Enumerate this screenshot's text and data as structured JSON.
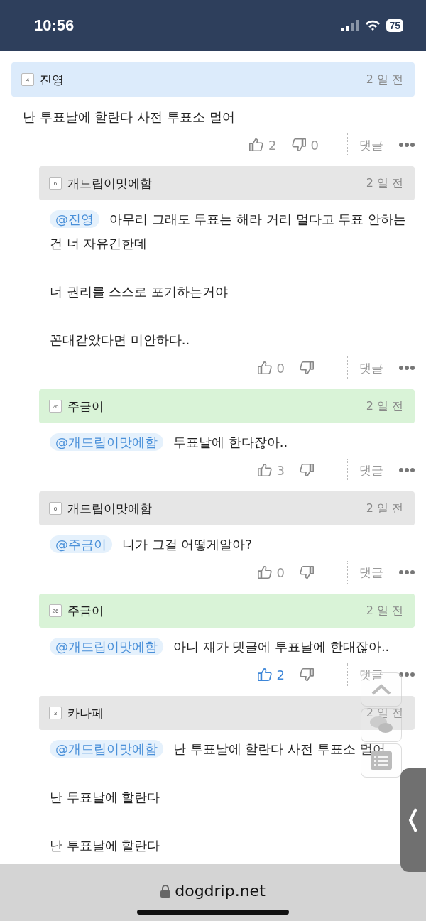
{
  "status_bar": {
    "time": "10:56",
    "battery": "75"
  },
  "comments": [
    {
      "badge": "4",
      "author": "진영",
      "time": "2 일 전",
      "color": "#dcebfb",
      "nested": false,
      "paragraphs": [
        "난 투표날에 할란다 사전 투표소 멀어"
      ],
      "likes": "2",
      "dislikes": "0",
      "liked": false,
      "reply": "댓글"
    },
    {
      "badge": "6",
      "author": "개드립이맛에함",
      "time": "2 일 전",
      "color": "#e6e6e6",
      "nested": true,
      "mention": "@진영",
      "paragraphs": [
        "아무리 그래도 투표는 해라 거리 멀다고 투표 안하는건 너 자유긴한데",
        "너 권리를 스스로 포기하는거야",
        "꼰대같았다면 미안하다.."
      ],
      "likes": "0",
      "liked": false,
      "reply": "댓글"
    },
    {
      "badge": "26",
      "author": "주금이",
      "time": "2 일 전",
      "color": "#d9f3d7",
      "nested": true,
      "mention": "@개드립이맛에함",
      "paragraphs": [
        "투표날에 한다잖아.."
      ],
      "likes": "3",
      "liked": false,
      "reply": "댓글"
    },
    {
      "badge": "6",
      "author": "개드립이맛에함",
      "time": "2 일 전",
      "color": "#e6e6e6",
      "nested": true,
      "mention": "@주금이",
      "paragraphs": [
        "니가 그걸 어떻게알아?"
      ],
      "likes": "0",
      "liked": false,
      "reply": "댓글"
    },
    {
      "badge": "26",
      "author": "주금이",
      "time": "2 일 전",
      "color": "#d9f3d7",
      "nested": true,
      "mention": "@개드립이맛에함",
      "paragraphs": [
        "아니 쟤가 댓글에 투표날에 한대잖아.."
      ],
      "likes": "2",
      "liked": true,
      "reply": "댓글"
    },
    {
      "badge": "3",
      "author": "카나페",
      "time": "2 일 전",
      "color": "#e6e6e6",
      "nested": true,
      "mention": "@개드립이맛에함",
      "paragraphs": [
        "난 투표날에 할란다 사전 투표소 멀어",
        "난 투표날에 할란다",
        "난 투표날에 할란다"
      ]
    }
  ],
  "url_bar": {
    "domain": "dogdrip.net"
  }
}
